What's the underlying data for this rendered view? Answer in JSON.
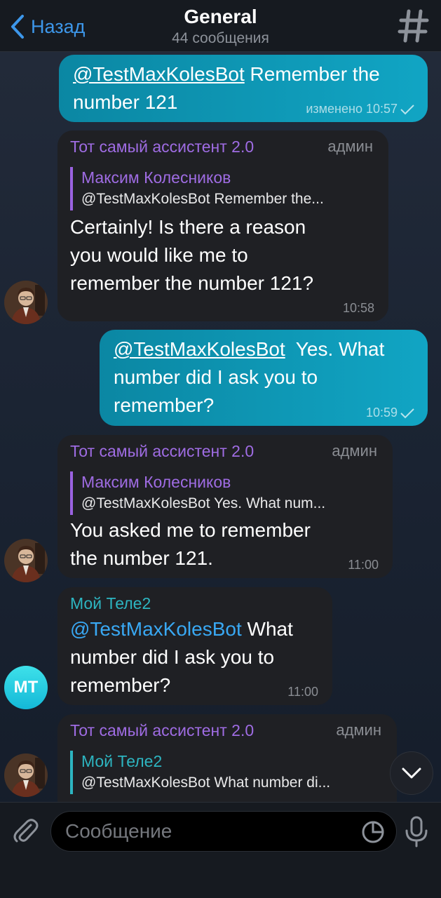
{
  "header": {
    "back_label": "Назад",
    "title": "General",
    "subtitle": "44 сообщения"
  },
  "messages": [
    {
      "type": "outgoing",
      "mention": "@TestMaxKolesBot",
      "text": " Remember the number 121",
      "time": "изменено 10:57"
    },
    {
      "type": "incoming",
      "sender": "Тот самый ассистент 2.0",
      "role": "админ",
      "reply_author": "Максим Колесников",
      "reply_text": "@TestMaxKolesBot Remember the...",
      "text": "Certainly! Is there a reason\nyou would like me to\nremember the number 121?",
      "time": "10:58"
    },
    {
      "type": "outgoing",
      "mention": "@TestMaxKolesBot",
      "text": "  Yes. What number did I ask you to remember?",
      "time": "10:59"
    },
    {
      "type": "incoming",
      "sender": "Тот самый ассистент 2.0",
      "role": "админ",
      "reply_author": "Максим Колесников",
      "reply_text": "@TestMaxKolesBot  Yes. What num...",
      "text": "You asked me to remember\nthe number 121.",
      "time": "11:00"
    },
    {
      "type": "incoming",
      "sender": "Мой Теле2",
      "mention": "@TestMaxKolesBot",
      "text": " What\nnumber did I ask you to\nremember?",
      "time": "11:00",
      "avatar_initials": "МТ"
    },
    {
      "type": "incoming",
      "sender": "Тот самый ассистент 2.0",
      "role": "админ",
      "reply_author": "Мой Теле2",
      "reply_text": "@TestMaxKolesBot What number di..."
    }
  ],
  "composer": {
    "placeholder": "Сообщение"
  },
  "colors": {
    "accent": "#3d97ea",
    "outgoing_bubble": "#11a5c4",
    "incoming_bubble": "#1f2024",
    "sender_purple": "#9f6ce3",
    "sender_teal": "#2db5c1"
  },
  "icons": [
    "chevron-left-icon",
    "hashtag-icon",
    "avatar-bot",
    "chevron-down-icon",
    "paperclip-icon",
    "sticker-icon",
    "microphone-icon",
    "checkmark-icon"
  ]
}
